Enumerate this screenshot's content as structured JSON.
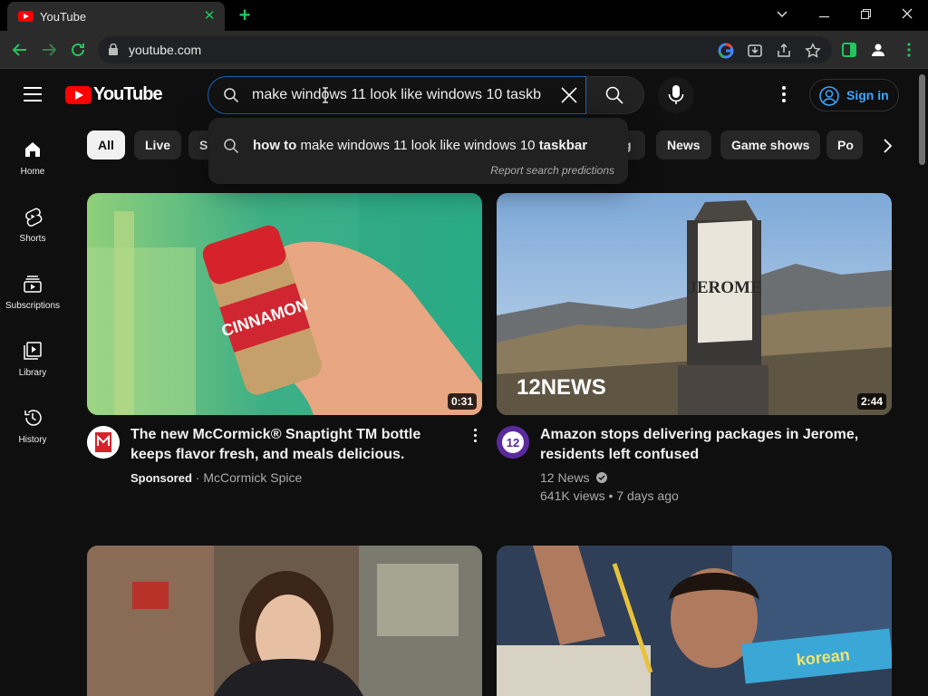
{
  "browser": {
    "tab_title": "YouTube",
    "tab_close": "✕",
    "new_tab": "+",
    "url": "youtube.com",
    "window_controls": {
      "minimize": "—",
      "restore": "❐",
      "close": "✕",
      "tab_list": "⌄"
    }
  },
  "masthead": {
    "logo_text": "YouTube",
    "search_value": "make windows 11 look like windows 10 taskb",
    "sign_in": "Sign in"
  },
  "suggestion": {
    "prefix": "how to",
    "middle": " make windows 11 look like windows 10 ",
    "suffix": "taskbar",
    "report": "Report search predictions"
  },
  "sidebar": [
    {
      "label": "Home",
      "icon": "home-icon"
    },
    {
      "label": "Shorts",
      "icon": "shorts-icon"
    },
    {
      "label": "Subscriptions",
      "icon": "subscriptions-icon"
    },
    {
      "label": "Library",
      "icon": "library-icon"
    },
    {
      "label": "History",
      "icon": "history-icon"
    }
  ],
  "chips": [
    "All",
    "Live",
    "S",
    "g",
    "News",
    "Game shows",
    "Po"
  ],
  "videos": [
    {
      "title": "The new McCormick® Snaptight TM bottle keeps flavor fresh, and meals delicious.",
      "duration": "0:31",
      "sponsored": "Sponsored",
      "separator": " · ",
      "channel": "McCormick Spice",
      "thumb_text": "CINNAMON"
    },
    {
      "title": "Amazon stops delivering packages in Jerome, residents left confused",
      "duration": "2:44",
      "channel": "12 News",
      "stats": "641K views • 7 days ago",
      "sign_text": "JEROME",
      "watermark": "12NEWS"
    }
  ],
  "colors": {
    "accent_green": "#22c55e",
    "yt_red": "#ff0000",
    "link_blue": "#3ea6ff",
    "bg": "#0f0f0f"
  }
}
